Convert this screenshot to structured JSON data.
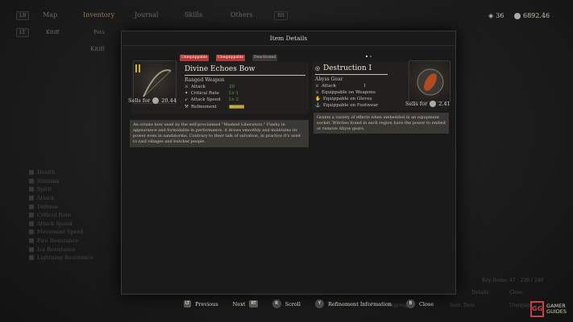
{
  "nav": {
    "left_btn": "LB",
    "tabs": [
      "Map",
      "Inventory",
      "Journal",
      "Skills",
      "Others"
    ],
    "right_btn": "RB",
    "sub_left_btn": "LT",
    "sub_tabs": [
      "Kitiff",
      "Pets"
    ],
    "sub_right_btn": "RT",
    "character_name": "Kitiff"
  },
  "resources": {
    "crystals": "36",
    "currency": "6892.46"
  },
  "sidebar_stats": [
    "Health",
    "Stamina",
    "Spirit",
    "Attack",
    "Defense",
    "Critical Rate",
    "Attack Speed",
    "Movement Speed",
    "Fire Resistance",
    "Ice Resistance",
    "Lightning Resistance"
  ],
  "modal": {
    "title": "Item Details",
    "left_item": {
      "badges": [
        "Unequippable",
        "Unequippable",
        "Deactivated"
      ],
      "name": "Divine Echoes Bow",
      "type": "Ranged Weapon",
      "stats": [
        {
          "icon": "attack-icon",
          "label": "Attack",
          "value": "20"
        },
        {
          "icon": "critical-icon",
          "label": "Critical Rate",
          "value": "Lv 1"
        },
        {
          "icon": "speed-icon",
          "label": "Attack Speed",
          "value": "Lv 2"
        },
        {
          "icon": "refine-icon",
          "label": "Refinement",
          "value": ""
        }
      ],
      "sells_label": "Sells for",
      "sells_value": "20.44",
      "description": "An ornate bow used by the self-proclaimed \"Masked Liberators.\" Flashy in appearance and formidable in performance, it draws smoothly and maintains its power even in sandstorms. Contrary to their talk of salvation, in practice it's used to raid villages and butcher people."
    },
    "right_item": {
      "name": "Destruction I",
      "type": "Abyss Gear",
      "stats": [
        {
          "icon": "attack-icon",
          "label": "Attack",
          "value": "1"
        },
        {
          "icon": "weapon-icon",
          "label": "Equippable on Weapons",
          "value": ""
        },
        {
          "icon": "gloves-icon",
          "label": "Equippable on Gloves",
          "value": ""
        },
        {
          "icon": "boots-icon",
          "label": "Equippable on Footwear",
          "value": ""
        }
      ],
      "sells_label": "Sells for",
      "sells_value": "2.41",
      "description": "Grants a variety of effects when embedded in an equipment socket. Witches found in each region have the power to embed or remove Abyss gears."
    }
  },
  "bottom_bar": [
    {
      "key": "LT",
      "label": "Previous"
    },
    {
      "key": "RT",
      "label": "Next"
    },
    {
      "key": "R",
      "label": "Scroll"
    },
    {
      "key": "Y",
      "label": "Refinement Information"
    },
    {
      "key": "B",
      "label": "Close"
    }
  ],
  "background_right": {
    "key_items": "Key Items: 47 · 230 / 240",
    "details": "Details",
    "close": "Close",
    "sort": "Sort: Date",
    "unequip": "Unequip",
    "ungroup": "Ungroup"
  },
  "logo": {
    "mark": "GG",
    "line1": "GAMER",
    "line2": "GUIDES"
  }
}
